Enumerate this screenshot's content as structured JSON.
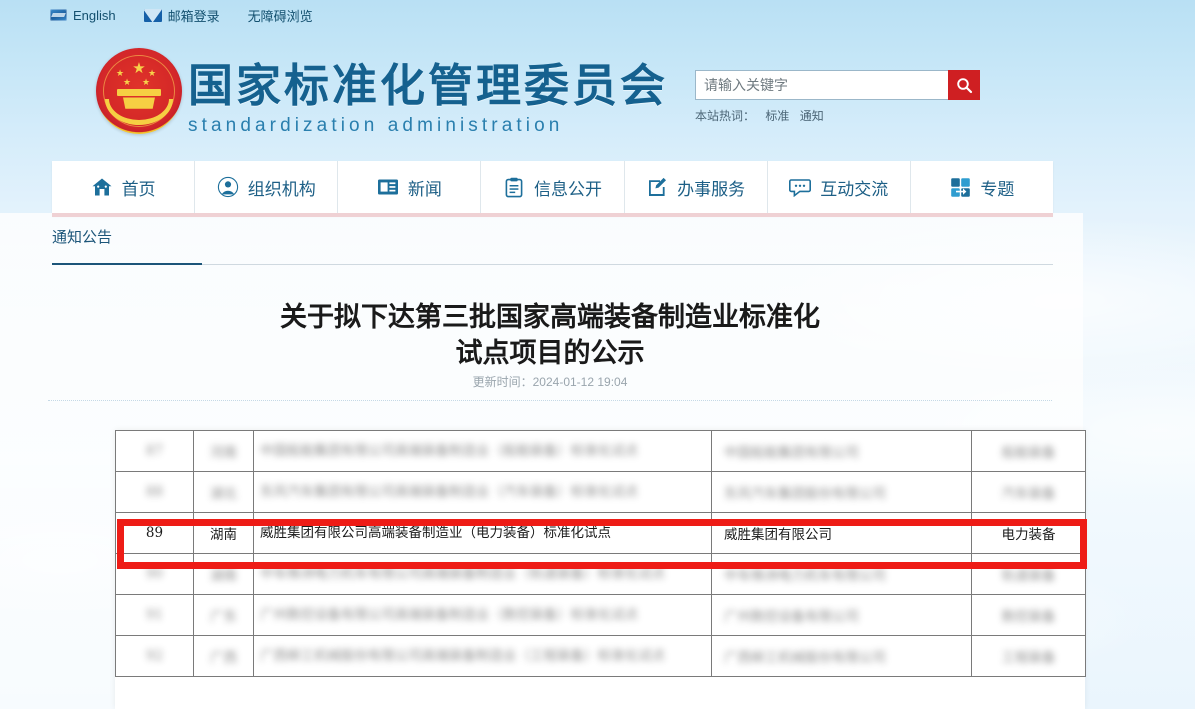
{
  "topbar": {
    "items": [
      {
        "icon": "sns-icon",
        "label": "English"
      },
      {
        "icon": "mail-icon",
        "label": "邮箱登录"
      },
      {
        "icon": "",
        "label": "无障碍浏览"
      }
    ]
  },
  "header": {
    "emblem_name": "national-emblem",
    "site_name_cn": "国家标准化管理委员会",
    "site_name_en": "standardization administration",
    "brand_color": "#15618f"
  },
  "search": {
    "placeholder": "请输入关键字",
    "value": "",
    "button_icon": "search-icon",
    "button_color": "#cf1f22",
    "hot_label": "本站热词：",
    "hot_words": [
      "标准",
      "通知"
    ]
  },
  "nav": {
    "accent_color": "#b01b28",
    "items": [
      {
        "icon": "home-icon",
        "label": "首页"
      },
      {
        "icon": "user-circle-icon",
        "label": "组织机构"
      },
      {
        "icon": "newspaper-icon",
        "label": "新闻"
      },
      {
        "icon": "clipboard-icon",
        "label": "信息公开"
      },
      {
        "icon": "pencil-square-icon",
        "label": "办事服务"
      },
      {
        "icon": "chat-bubble-icon",
        "label": "互动交流"
      },
      {
        "icon": "grid-arrow-icon",
        "label": "专题"
      }
    ]
  },
  "breadcrumb": {
    "current": "通知公告"
  },
  "article": {
    "title": "关于拟下达第三批国家高端装备制造业标准化试点项目的公示",
    "title_line1": "关于拟下达第三批国家高端装备制造业标准化",
    "title_line2": "试点项目的公示",
    "meta_label": "更新时间：",
    "meta_time": "2024-01-12 19:04"
  },
  "table": {
    "highlight_color": "#ee1c16",
    "rows": [
      {
        "no": "87",
        "province": "河南",
        "name": "中国船舶集团有限公司高端装备制造业（船舶装备）标准化试点",
        "org": "中国船舶集团有限公司",
        "field": "船舶装备",
        "blurred": true
      },
      {
        "no": "88",
        "province": "湖北",
        "name": "东风汽车集团有限公司高端装备制造业（汽车装备）标准化试点",
        "org": "东风汽车集团股份有限公司",
        "field": "汽车装备",
        "blurred": true
      },
      {
        "no": "89",
        "province": "湖南",
        "name": "威胜集团有限公司高端装备制造业（电力装备）标准化试点",
        "org": "威胜集团有限公司",
        "field": "电力装备",
        "blurred": false
      },
      {
        "no": "90",
        "province": "湖南",
        "name": "中车株洲电力机车有限公司高端装备制造业（轨道装备）标准化试点",
        "org": "中车株洲电力机车有限公司",
        "field": "轨道装备",
        "blurred": true
      },
      {
        "no": "91",
        "province": "广东",
        "name": "广州数控设备有限公司高端装备制造业（数控装备）标准化试点",
        "org": "广州数控设备有限公司",
        "field": "数控装备",
        "blurred": true
      },
      {
        "no": "92",
        "province": "广西",
        "name": "广西柳工机械股份有限公司高端装备制造业（工程装备）标准化试点",
        "org": "广西柳工机械股份有限公司",
        "field": "工程装备",
        "blurred": true
      }
    ]
  }
}
